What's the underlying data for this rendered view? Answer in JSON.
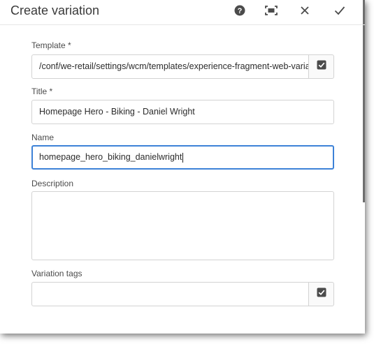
{
  "dialog": {
    "title": "Create variation",
    "actions": {
      "help_icon": "help-circle-icon",
      "fullscreen_icon": "fullscreen-icon",
      "close_icon": "close-icon",
      "done_icon": "checkmark-icon"
    }
  },
  "form": {
    "template": {
      "label": "Template *",
      "value": "/conf/we-retail/settings/wcm/templates/experience-fragment-web-variation",
      "picker_icon": "checkbox-checked-icon"
    },
    "title": {
      "label": "Title *",
      "value": "Homepage Hero - Biking - Daniel Wright"
    },
    "name": {
      "label": "Name",
      "value": "homepage_hero_biking_danielwright"
    },
    "description": {
      "label": "Description",
      "value": ""
    },
    "variation_tags": {
      "label": "Variation tags",
      "value": "",
      "picker_icon": "checkbox-checked-icon"
    }
  },
  "colors": {
    "focus_border": "#3d82d7",
    "icon_dark": "#4b4b4b",
    "field_border": "#d3d3d3"
  }
}
